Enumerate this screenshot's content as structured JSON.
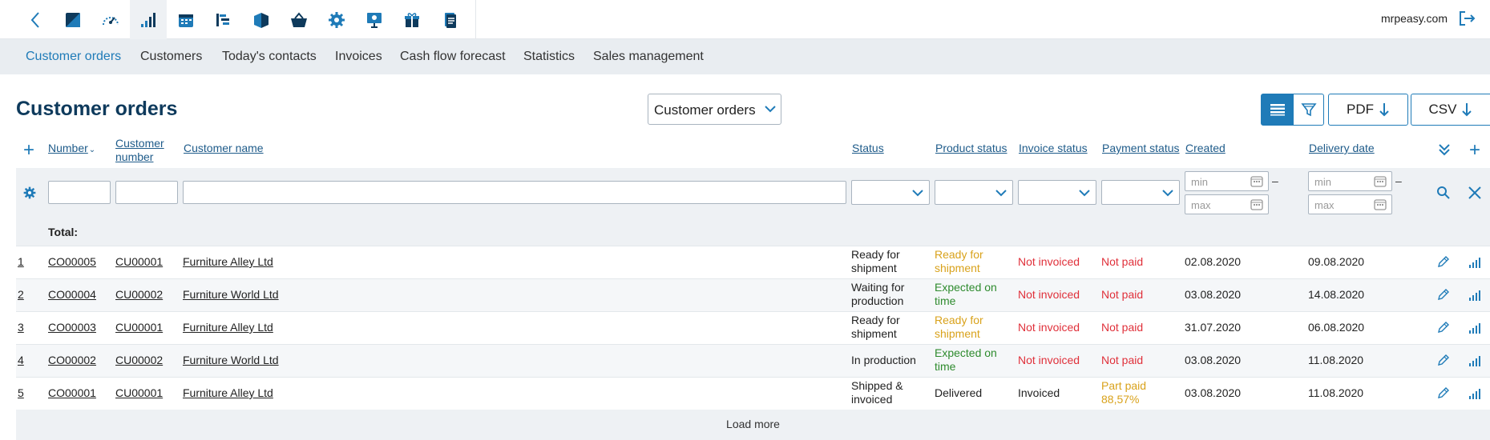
{
  "topbar": {
    "domain": "mrpeasy.com",
    "icons": [
      "back-icon",
      "stock-icon",
      "speedometer-icon",
      "signal-bars-icon",
      "calendar-icon",
      "gantt-icon",
      "box-icon",
      "basket-icon",
      "gear-icon",
      "presentation-icon",
      "gift-icon",
      "document-icon"
    ]
  },
  "subnav": {
    "items": [
      "Customer orders",
      "Customers",
      "Today's contacts",
      "Invoices",
      "Cash flow forecast",
      "Statistics",
      "Sales management"
    ]
  },
  "page": {
    "title": "Customer orders",
    "view_select": "Customer orders",
    "pdf_label": "PDF",
    "csv_label": "CSV"
  },
  "table": {
    "headers": {
      "number": "Number",
      "customer_number_1": "Customer",
      "customer_number_2": "number",
      "customer_name": "Customer name",
      "status": "Status",
      "product_status": "Product status",
      "invoice_status": "Invoice status",
      "payment_status": "Payment status",
      "created": "Created",
      "delivery_date": "Delivery date"
    },
    "filters": {
      "min_placeholder": "min",
      "max_placeholder": "max"
    },
    "total_label": "Total:",
    "rows": [
      {
        "idx": "1",
        "number": "CO00005",
        "cust_num": "CU00001",
        "cust_name": "Furniture Alley Ltd",
        "status_1": "Ready for",
        "status_2": "shipment",
        "prod_1": "Ready for",
        "prod_2": "shipment",
        "prod_color": "yellow",
        "invoice": "Not invoiced",
        "invoice_color": "red",
        "pay_1": "Not paid",
        "pay_2": "",
        "pay_color": "red",
        "created": "02.08.2020",
        "delivery": "09.08.2020"
      },
      {
        "idx": "2",
        "number": "CO00004",
        "cust_num": "CU00002",
        "cust_name": "Furniture World Ltd",
        "status_1": "Waiting for",
        "status_2": "production",
        "prod_1": "Expected on",
        "prod_2": "time",
        "prod_color": "green",
        "invoice": "Not invoiced",
        "invoice_color": "red",
        "pay_1": "Not paid",
        "pay_2": "",
        "pay_color": "red",
        "created": "03.08.2020",
        "delivery": "14.08.2020"
      },
      {
        "idx": "3",
        "number": "CO00003",
        "cust_num": "CU00001",
        "cust_name": "Furniture Alley Ltd",
        "status_1": "Ready for",
        "status_2": "shipment",
        "prod_1": "Ready for",
        "prod_2": "shipment",
        "prod_color": "yellow",
        "invoice": "Not invoiced",
        "invoice_color": "red",
        "pay_1": "Not paid",
        "pay_2": "",
        "pay_color": "red",
        "created": "31.07.2020",
        "delivery": "06.08.2020"
      },
      {
        "idx": "4",
        "number": "CO00002",
        "cust_num": "CU00002",
        "cust_name": "Furniture World Ltd",
        "status_1": "In production",
        "status_2": "",
        "prod_1": "Expected on",
        "prod_2": "time",
        "prod_color": "green",
        "invoice": "Not invoiced",
        "invoice_color": "red",
        "pay_1": "Not paid",
        "pay_2": "",
        "pay_color": "red",
        "created": "03.08.2020",
        "delivery": "11.08.2020"
      },
      {
        "idx": "5",
        "number": "CO00001",
        "cust_num": "CU00001",
        "cust_name": "Furniture Alley Ltd",
        "status_1": "Shipped &",
        "status_2": "invoiced",
        "prod_1": "Delivered",
        "prod_2": "",
        "prod_color": "default",
        "invoice": "Invoiced",
        "invoice_color": "default",
        "pay_1": "Part paid",
        "pay_2": "88,57%",
        "pay_color": "yellow",
        "created": "03.08.2020",
        "delivery": "11.08.2020"
      }
    ],
    "load_more": "Load more"
  },
  "colors": {
    "accent": "#1f7bb8",
    "title": "#0e3a5c",
    "yellow": "#d9a21b",
    "green": "#2e8b2e",
    "red": "#e0303a"
  }
}
